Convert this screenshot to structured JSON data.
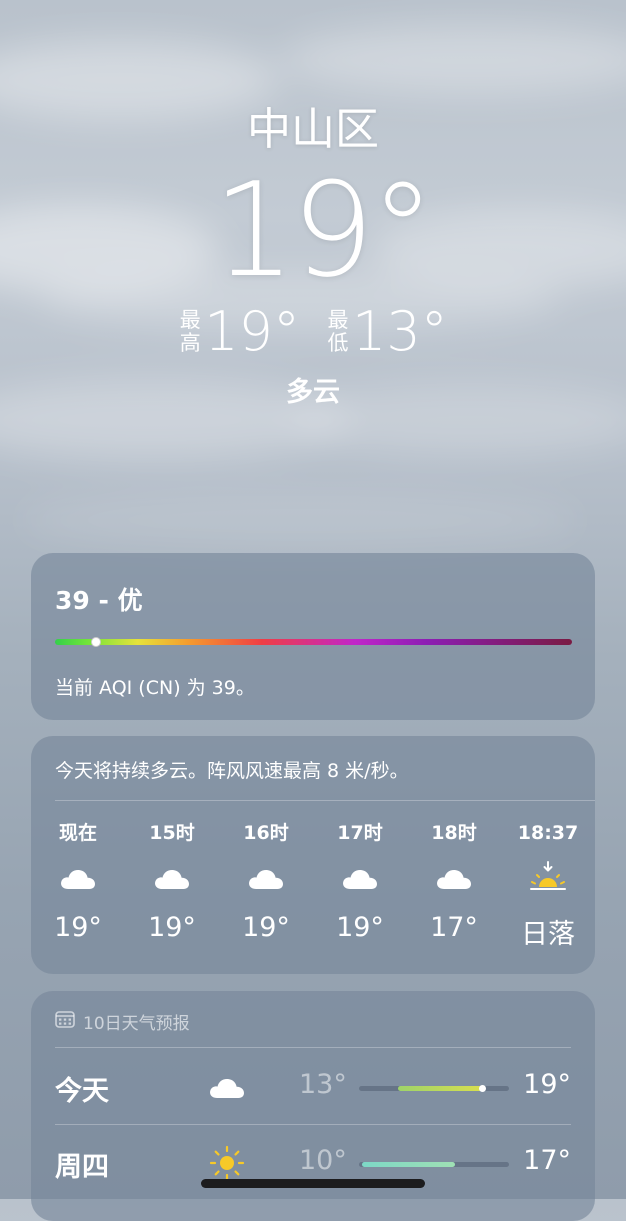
{
  "location": {
    "city": "中山区",
    "temperature": "19°",
    "high_label_1": "最",
    "high_label_2": "高",
    "high": "19°",
    "low_label_1": "最",
    "low_label_2": "低",
    "low": "13°",
    "condition": "多云"
  },
  "aqi": {
    "title": "39 - 优",
    "description": "当前 AQI (CN) 为 39。",
    "level": 0.08,
    "colors": [
      "#34d04b",
      "#e6e23a",
      "#ef3e45",
      "#c026c9",
      "#7a1b43"
    ]
  },
  "hourly": {
    "summary": "今天将持续多云。阵风风速最高 8 米/秒。",
    "items": [
      {
        "time": "现在",
        "icon": "cloud-icon",
        "temp": "19°"
      },
      {
        "time": "15时",
        "icon": "cloud-icon",
        "temp": "19°"
      },
      {
        "time": "16时",
        "icon": "cloud-icon",
        "temp": "19°"
      },
      {
        "time": "17时",
        "icon": "cloud-icon",
        "temp": "19°"
      },
      {
        "time": "18时",
        "icon": "cloud-icon",
        "temp": "17°"
      },
      {
        "time": "18:37",
        "icon": "sunset-icon",
        "temp": "日落"
      }
    ]
  },
  "forecast": {
    "header": "10日天气预报",
    "header_icon": "calendar-icon",
    "days": [
      {
        "day": "今天",
        "icon": "cloud-icon",
        "low": "13°",
        "high": "19°",
        "range_start": 0.26,
        "range_end": 0.82,
        "current": 0.82,
        "color_from": "#9ed36a",
        "color_to": "#d8df4e"
      },
      {
        "day": "周四",
        "icon": "sun-icon",
        "low": "10°",
        "high": "17°",
        "range_start": 0.02,
        "range_end": 0.64,
        "current": null,
        "color_from": "#7dd8c6",
        "color_to": "#9fe0b4"
      }
    ]
  }
}
